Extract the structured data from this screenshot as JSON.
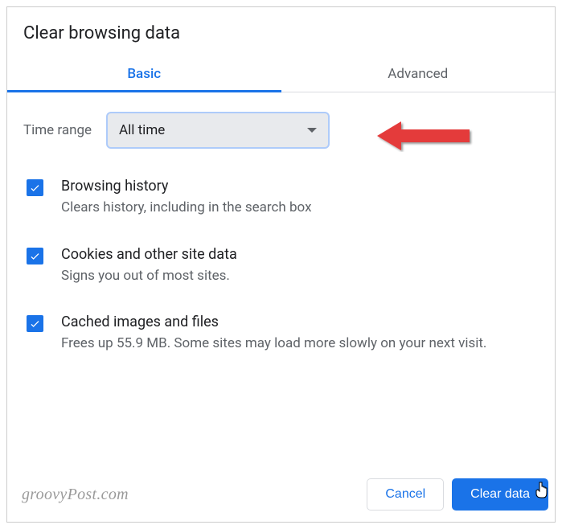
{
  "dialog": {
    "title": "Clear browsing data"
  },
  "tabs": {
    "basic": "Basic",
    "advanced": "Advanced"
  },
  "timerange": {
    "label": "Time range",
    "value": "All time"
  },
  "options": [
    {
      "title": "Browsing history",
      "desc": "Clears history, including in the search box"
    },
    {
      "title": "Cookies and other site data",
      "desc": "Signs you out of most sites."
    },
    {
      "title": "Cached images and files",
      "desc": "Frees up 55.9 MB. Some sites may load more slowly on your next visit."
    }
  ],
  "buttons": {
    "cancel": "Cancel",
    "clear": "Clear data"
  },
  "watermark": "groovyPost.com"
}
